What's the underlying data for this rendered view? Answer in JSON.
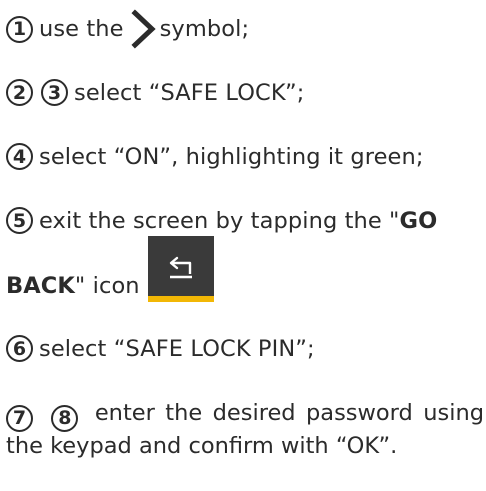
{
  "steps": {
    "s1": {
      "num": "1",
      "text_a": "use the",
      "text_b": "symbol;"
    },
    "s23": {
      "num_a": "2",
      "num_b": "3",
      "text": "select “SAFE LOCK”;"
    },
    "s4": {
      "num": "4",
      "text": "select “ON”, highlighting it green;"
    },
    "s5": {
      "num": "5",
      "text_a": "exit the screen by tapping the \"",
      "bold_a": "GO",
      "bold_b": "BACK",
      "text_b": "\" icon"
    },
    "s6": {
      "num": "6",
      "text": "select “SAFE LOCK PIN”;"
    },
    "s78": {
      "num_a": "7",
      "num_b": "8",
      "text": "enter the desired password using the keypad and confirm with “OK”."
    }
  },
  "icons": {
    "chevron": "chevron-right-icon",
    "go_back": "go-back-icon"
  },
  "colors": {
    "text": "#2b2b2b",
    "button_bg": "#3a3a3a",
    "button_accent": "#f2b705"
  }
}
